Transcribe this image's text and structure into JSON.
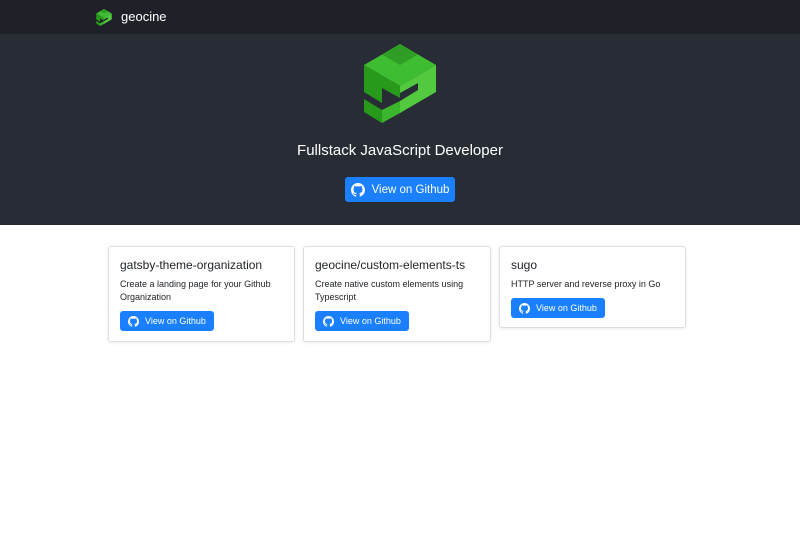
{
  "navbar": {
    "brand_name": "geocine"
  },
  "hero": {
    "title": "Fullstack JavaScript Developer",
    "button_label": "View on Github"
  },
  "projects": [
    {
      "name": "gatsby-theme-organization",
      "description": "Create a landing page for your Github Organization",
      "button_label": "View on Github"
    },
    {
      "name": "geocine/custom-elements-ts",
      "description": "Create native custom elements using Typescript",
      "button_label": "View on Github"
    },
    {
      "name": "sugo",
      "description": "HTTP server and reverse proxy in Go",
      "button_label": "View on Github"
    }
  ],
  "icons": {
    "brand": "geocine-logo-icon",
    "button": "github-icon"
  },
  "colors": {
    "navbar_bg": "#1e2127",
    "hero_bg": "#282c34",
    "primary": "#1a80ff",
    "logo_green": "#3cb52e"
  }
}
